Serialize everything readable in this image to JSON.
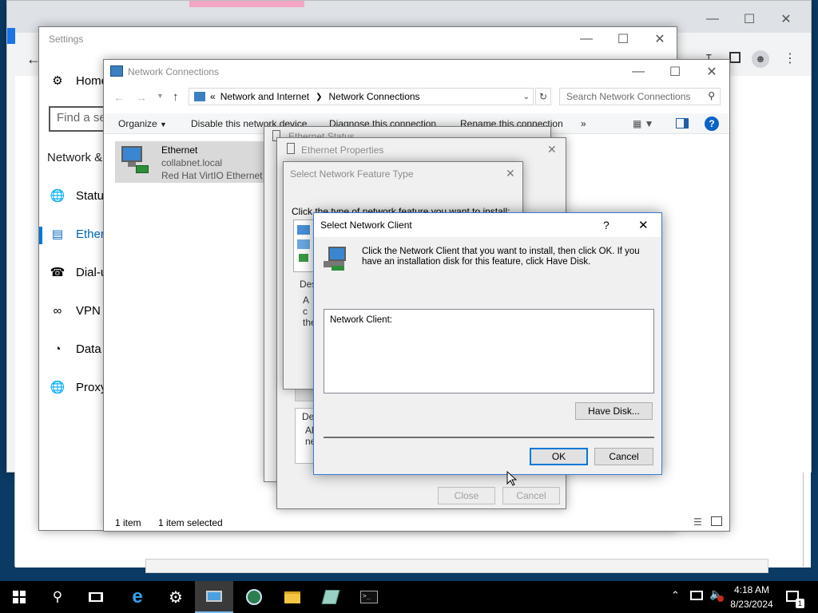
{
  "settings": {
    "title": "Settings",
    "home": "Home",
    "find_placeholder": "Find a se",
    "section": "Network &",
    "nav": [
      "Status",
      "Ethernet",
      "Dial-up",
      "VPN",
      "Data",
      "Proxy"
    ]
  },
  "netconn": {
    "title": "Network Connections",
    "breadcrumb": [
      "«",
      "Network and Internet",
      "Network Connections"
    ],
    "search_placeholder": "Search Network Connections",
    "toolbar": [
      "Organize",
      "Disable this network device",
      "Diagnose this connection",
      "Rename this connection",
      "»"
    ],
    "item": {
      "name": "Ethernet",
      "domain": "collabnet.local",
      "adapter": "Red Hat VirtIO Ethernet A"
    },
    "status_count": "1 item",
    "status_selected": "1 item selected"
  },
  "eth_status": {
    "title": "Ethernet Status",
    "close": "Close",
    "cancel": "Cancel"
  },
  "eth_props": {
    "title": "Ethernet Properties",
    "desc_label": "Des",
    "desc_text": "All ne"
  },
  "feature_type": {
    "title": "Select Network Feature Type",
    "instruction": "Click the type of network feature you want to install:",
    "desc_label": "Desc",
    "desc_text": "A c the"
  },
  "net_client": {
    "title": "Select Network Client",
    "help": "?",
    "message": "Click the Network Client that you want to install, then click OK. If you have an installation disk for this feature, click Have Disk.",
    "list_header": "Network Client:",
    "have_disk": "Have Disk...",
    "ok": "OK",
    "cancel": "Cancel"
  },
  "taskbar": {
    "time": "4:18 AM",
    "date": "8/23/2024",
    "notification_count": "1"
  },
  "colors": {
    "accent": "#0078d7",
    "taskbar": "#000000",
    "desktop": "#0b3a64"
  }
}
